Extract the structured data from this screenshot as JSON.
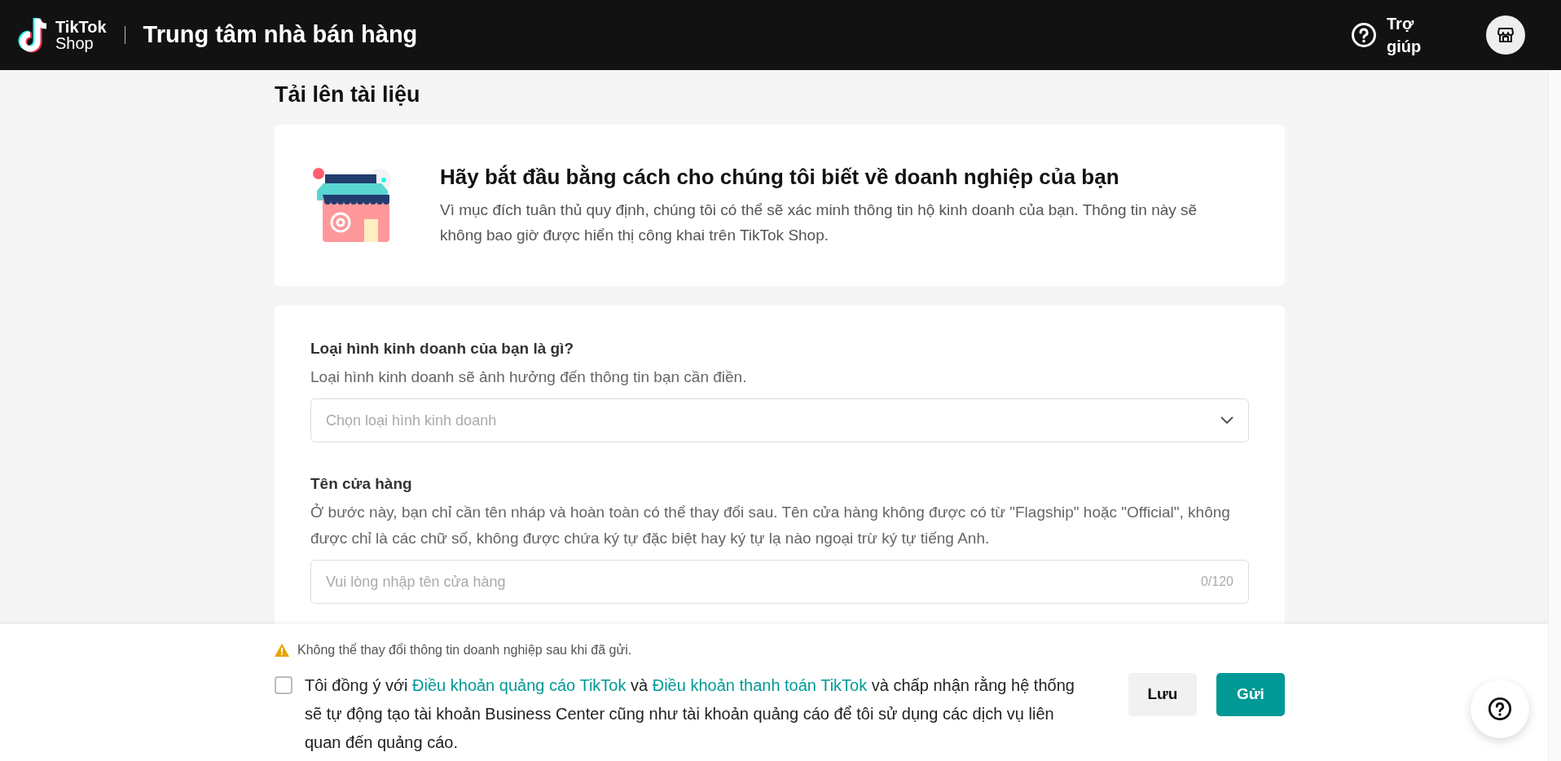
{
  "header": {
    "logo_top": "TikTok",
    "logo_bottom": "Shop",
    "title": "Trung tâm nhà bán hàng",
    "help_label": "Trợ giúp"
  },
  "page_title": "Tải lên tài liệu",
  "intro": {
    "heading": "Hãy bắt đầu bằng cách cho chúng tôi biết về doanh nghiệp của bạn",
    "description": "Vì mục đích tuân thủ quy định, chúng tôi có thể sẽ xác minh thông tin hộ kinh doanh của bạn. Thông tin này sẽ không bao giờ được hiển thị công khai trên TikTok Shop."
  },
  "form": {
    "fields": [
      {
        "kind": "select",
        "label": "Loại hình kinh doanh của bạn là gì?",
        "hint": "Loại hình kinh doanh sẽ ảnh hưởng đến thông tin bạn cần điền.",
        "placeholder": "Chọn loại hình kinh doanh"
      },
      {
        "kind": "text",
        "label": "Tên cửa hàng",
        "hint": "Ở bước này, bạn chỉ cần tên nháp và hoàn toàn có thể thay đổi sau. Tên cửa hàng không được có từ \"Flagship\" hoặc \"Official\", không được chỉ là các chữ số, không được chứa ký tự đặc biệt hay ký tự lạ nào ngoại trừ ký tự tiếng Anh.",
        "placeholder": "Vui lòng nhập tên cửa hàng",
        "counter": "0/120"
      }
    ]
  },
  "footer": {
    "warning": "Không thể thay đổi thông tin doanh nghiệp sau khi đã gửi.",
    "agreement": {
      "checked": false,
      "segments": [
        {
          "kind": "text",
          "text": "Tôi đồng ý với "
        },
        {
          "kind": "link",
          "text": "Điều khoản quảng cáo TikTok"
        },
        {
          "kind": "text",
          "text": " và "
        },
        {
          "kind": "link",
          "text": "Điều khoản thanh toán TikTok"
        },
        {
          "kind": "text",
          "text": " và chấp nhận rằng hệ thống sẽ tự động tạo tài khoản Business Center cũng như tài khoản quảng cáo để tôi sử dụng các dịch vụ liên quan đến quảng cáo."
        }
      ]
    },
    "buttons": [
      {
        "kind": "secondary",
        "label": "Lưu"
      },
      {
        "kind": "primary",
        "label": "Gửi"
      }
    ]
  }
}
